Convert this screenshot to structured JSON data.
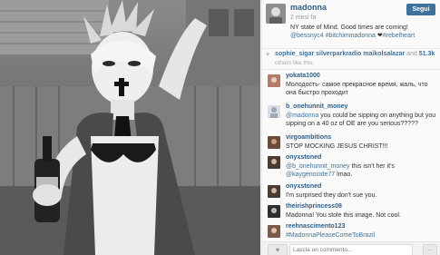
{
  "post": {
    "username": "madonna",
    "time": "2 mesi fa",
    "follow_label": "Segui",
    "caption_text": "NY state of Mind. Good times are coming! ",
    "caption_tags": [
      "@bessnyc4",
      "#bitchimmadonna",
      "❤",
      "#rebelheart"
    ]
  },
  "likes": {
    "users": "sophie_sigar silverparkradio maikolsalazar",
    "and": "and",
    "count": "51.3k",
    "sub": "others like this."
  },
  "comments": [
    {
      "user": "yokata1000",
      "text": "Молодость- самое прекрасное время, жаль, что она быстро проходит",
      "mention": "",
      "rest": ""
    },
    {
      "user": "b_onehunnit_money",
      "text": "",
      "mention": "@madonna",
      "rest": " you could be sipping on anything but you sipping on a 40 oz of OE are you serious?????"
    },
    {
      "user": "virgoambitions",
      "text": "STOP MOCKING JESUS CHRIST!!!",
      "mention": "",
      "rest": ""
    },
    {
      "user": "onyxstoned",
      "text": "",
      "mention": "@b_onehunnit_money",
      "rest": " this isn't her it's ",
      "mention2": "@kaygenocide77",
      "rest2": " lmao."
    },
    {
      "user": "onyxstoned",
      "text": "I'm surprised they don't sue you.",
      "mention": "",
      "rest": ""
    },
    {
      "user": "theirishprincess08",
      "text": "Madonna! You stole this image. Not cool.",
      "mention": "",
      "rest": ""
    },
    {
      "user": "reehnascimento123",
      "text": "",
      "mention": "#MadonnaPleaseComeToBrazil",
      "rest": ""
    }
  ],
  "input": {
    "placeholder": "Lascia un commento..."
  },
  "more_label": "...",
  "icons": {
    "like": "heart-icon",
    "likes": "small-heart-icon",
    "more": "more-icon"
  },
  "colors": {
    "accent": "#3f729b",
    "username": "#2f5d86"
  }
}
